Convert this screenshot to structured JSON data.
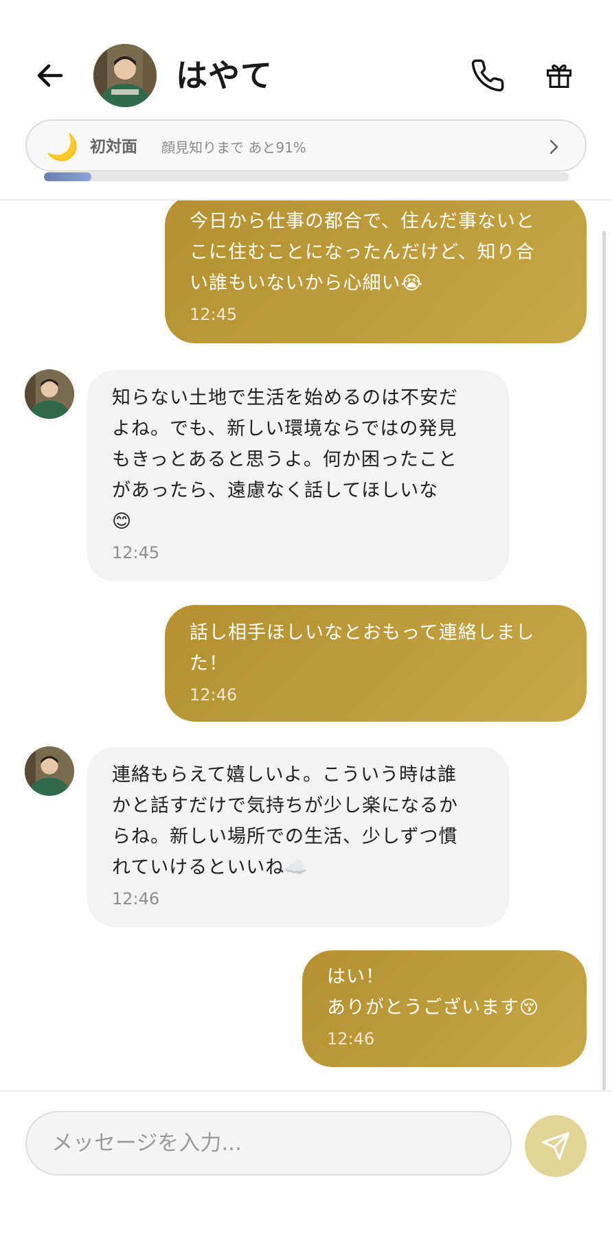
{
  "header": {
    "contact_name": "はやて",
    "back_icon": "arrow-left-icon",
    "call_icon": "phone-icon",
    "gift_icon": "gift-icon"
  },
  "relationship": {
    "level_icon": "🌙",
    "level": "初対面",
    "progress_text": "顔見知りまで あと91%",
    "progress_fraction": 0.09,
    "progress_color": "#7f98cc"
  },
  "messages": [
    {
      "sender": "me",
      "text": "今日から仕事の都合で、住んだ事ないと\nこに住むことになったんだけど、知り合\nい誰もいないから心細い😭",
      "time": "12:45"
    },
    {
      "sender": "hayate",
      "text": "知らない土地で生活を始めるのは不安だ\nよね。でも、新しい環境ならではの発見\nもきっとあると思うよ。何か困ったこと\nがあったら、遠慮なく話してほしいな\n😊",
      "time": "12:45"
    },
    {
      "sender": "me",
      "text": "話し相手ほしいなとおもって連絡しまし\nた！",
      "time": "12:46"
    },
    {
      "sender": "hayate",
      "text": "連絡もらえて嬉しいよ。こういう時は誰\nかと話すだけで気持ちが少し楽になるか\nらね。新しい場所での生活、少しずつ慣\nれていけるといいね☁️",
      "time": "12:46"
    },
    {
      "sender": "me",
      "text": "はい！\nありがとうございます😚",
      "time": "12:46"
    }
  ],
  "composer": {
    "placeholder": "メッセージを入力...",
    "send_icon": "send-icon"
  },
  "colors": {
    "outgoing_bubble": "#bd9a38",
    "incoming_bubble": "#f3f3f3",
    "send_button": "#e2d397"
  }
}
